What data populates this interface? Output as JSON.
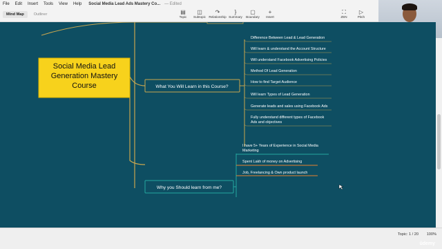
{
  "menubar": {
    "items": [
      "File",
      "Edit",
      "Insert",
      "Tools",
      "View",
      "Help"
    ],
    "doc_title": "Social Media Lead Ads Mastery Co...",
    "edited": "— Edited"
  },
  "toolbar": {
    "tabs": [
      "Mind Map",
      "Outliner"
    ],
    "tools": [
      {
        "label": "Topic",
        "icon": "topic-icon"
      },
      {
        "label": "Subtopic",
        "icon": "subtopic-icon"
      },
      {
        "label": "Relationship",
        "icon": "relationship-icon"
      },
      {
        "label": "Summary",
        "icon": "summary-icon"
      },
      {
        "label": "Boundary",
        "icon": "boundary-icon"
      },
      {
        "label": "Insert",
        "icon": "plus-icon"
      },
      {
        "label": "ZEN",
        "icon": "zen-icon"
      },
      {
        "label": "Pitch",
        "icon": "pitch-icon"
      }
    ]
  },
  "mindmap": {
    "central": [
      "Social Media Lead",
      "Generation Mastery",
      "Course"
    ],
    "branch1": {
      "label": "What You Will Learn in this Course?",
      "items": [
        [
          "Difference Between Lead & Lead Generation"
        ],
        [
          "Will learn & understand the Account Structure"
        ],
        [
          "Will understand Facebook Advertising Policies"
        ],
        [
          "Method Of Lead Generation"
        ],
        [
          "How to find Target Audience"
        ],
        [
          "Will learn Types of Lead Generation"
        ],
        [
          "Generate leads and sales using Facebook Ads"
        ],
        [
          "Fully understand different types of Facebook",
          "Ads and objectives"
        ]
      ]
    },
    "branch2": {
      "label": "Why you Should learn from me?",
      "items": [
        [
          "I have 5+ Years of Experience in Social Media",
          "Marketing"
        ],
        [
          "Spent Lakh of money on Advertising"
        ],
        [
          "Job, Freelancing & Own product launch"
        ]
      ]
    }
  },
  "status": {
    "topic": "Topic: 1 / 20",
    "zoom": "100%",
    "watermark": "ûdemy"
  },
  "colors": {
    "canvas": "#0e4e62",
    "central": "#f7d21c",
    "branch_line": "#c8a64f",
    "teal": "#24a8a0",
    "orange": "#e8822f"
  }
}
